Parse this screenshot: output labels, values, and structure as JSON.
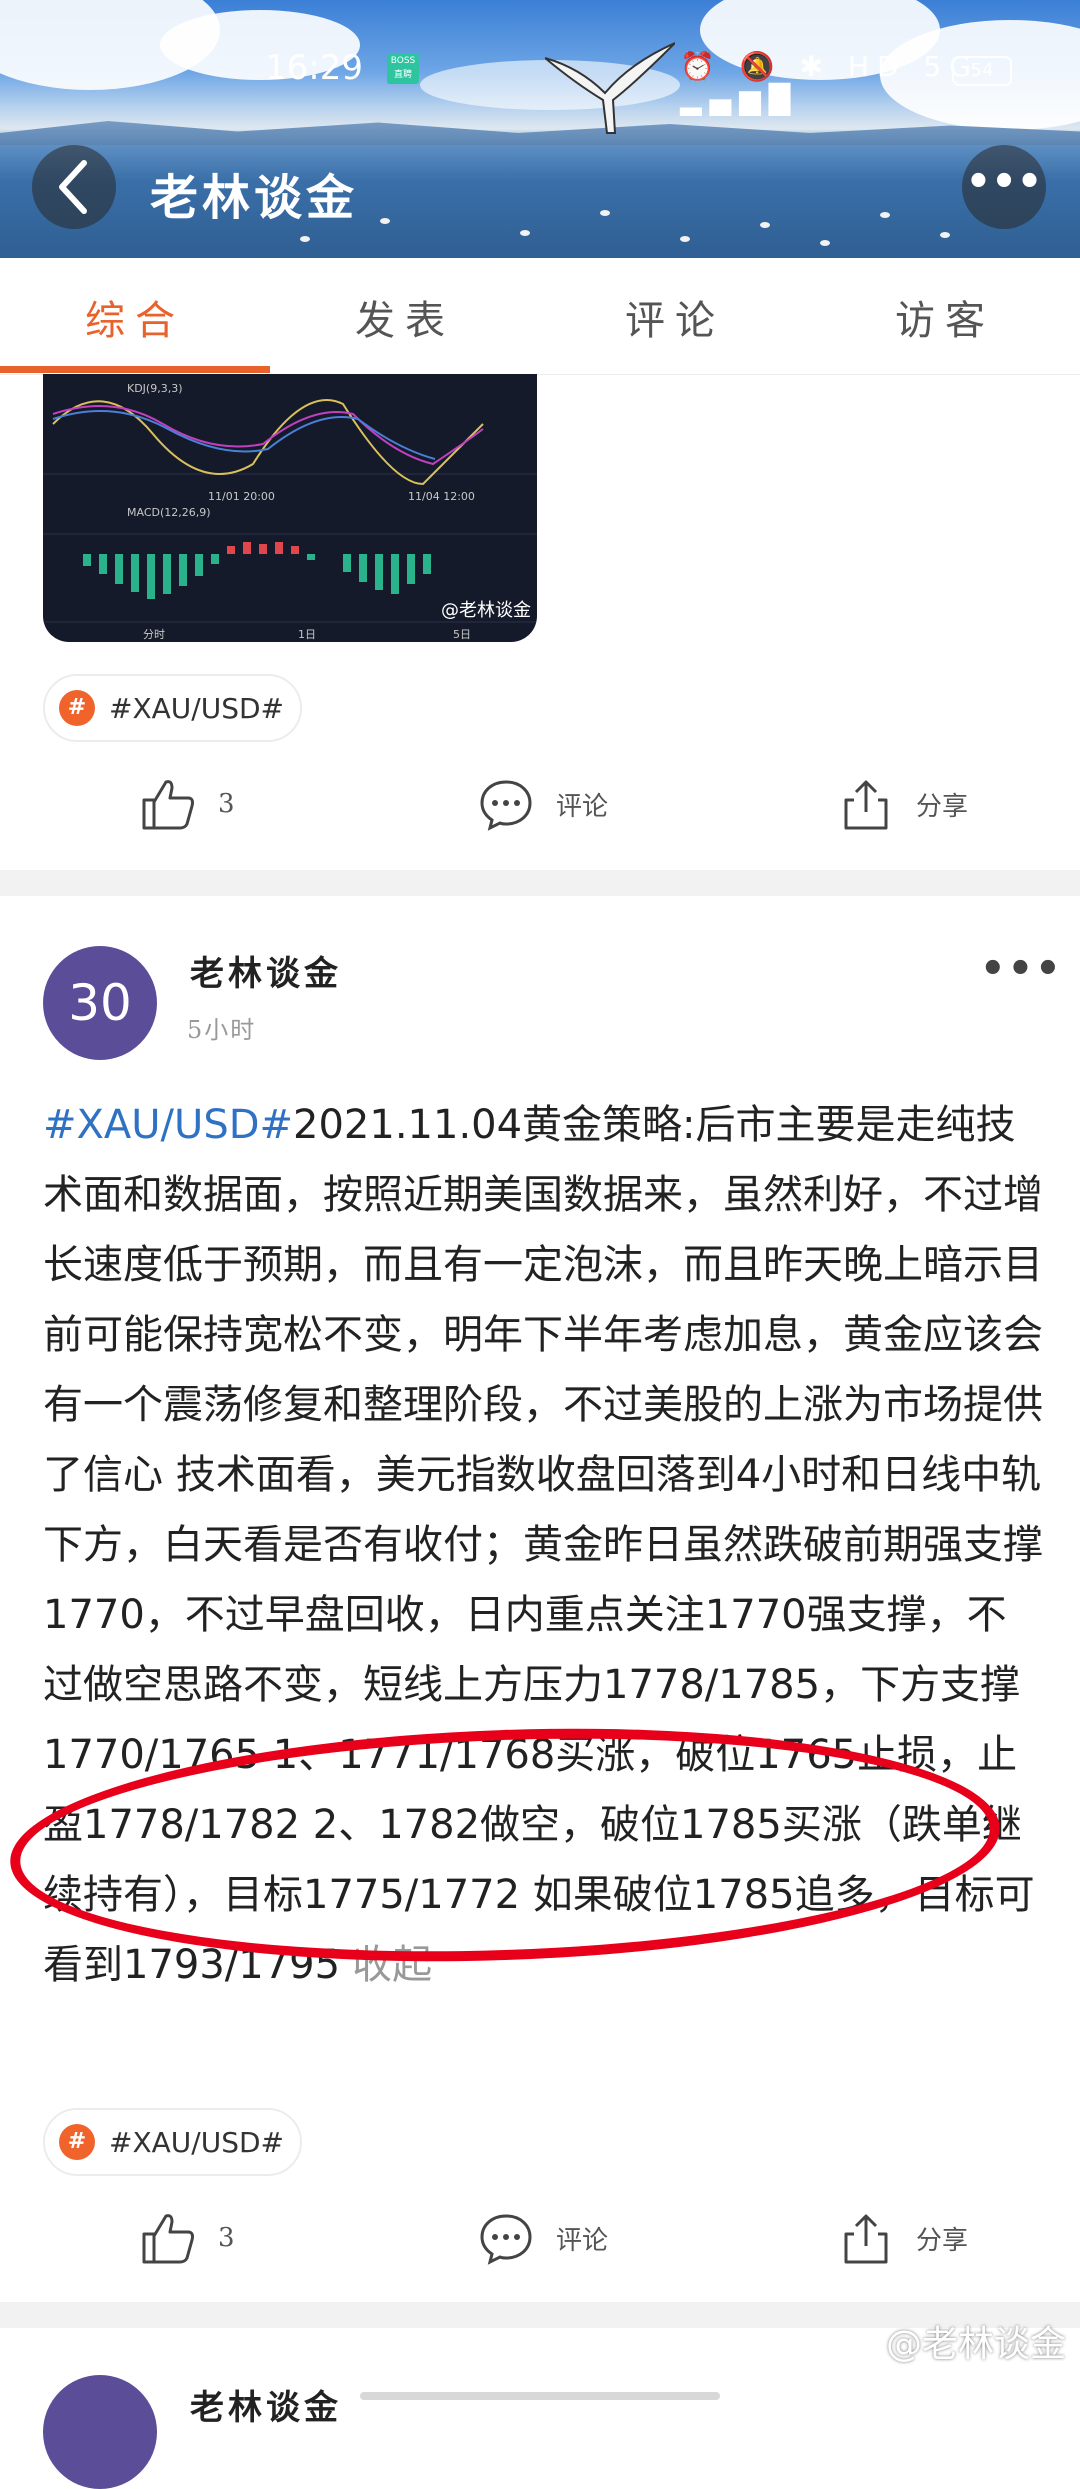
{
  "status_bar": {
    "time": "16:29",
    "boss_badge_top": "BOSS",
    "boss_badge_bottom": "直聘",
    "icons": "⏰ 🔕 ✱ HD 5G ▂▄▆█",
    "battery": "54"
  },
  "header": {
    "title": "老林谈金",
    "back_icon": "chevron-left-icon",
    "more_icon": "more-dots-icon"
  },
  "tabs": [
    {
      "label": "综合",
      "active": true
    },
    {
      "label": "发表",
      "active": false
    },
    {
      "label": "评论",
      "active": false
    },
    {
      "label": "访客",
      "active": false
    }
  ],
  "accent_color": "#e8622c",
  "prev_post": {
    "chart_labels": {
      "kdj": "KDJ(9,3,3)",
      "macd": "MACD(12,26,9)",
      "date1": "11/01 20:00",
      "date2": "11/04 12:00",
      "tab1": "分时",
      "tab2": "1日",
      "tab3": "5日",
      "watermark": "@老林谈金"
    },
    "tag": "#XAU/USD#",
    "likes": "3",
    "comment_label": "评论",
    "share_label": "分享"
  },
  "post": {
    "avatar_text": "30",
    "author": "老林谈金",
    "time_ago": "5小时",
    "tag_inline": "#XAU/USD#",
    "body": "2021.11.04黄金策略:后市主要是走纯技术面和数据面，按照近期美国数据来，虽然利好，不过增长速度低于预期，而且有一定泡沫，而且昨天晚上暗示目前可能保持宽松不变，明年下半年考虑加息，黄金应该会有一个震荡修复和整理阶段，不过美股的上涨为市场提供了信心 技术面看，美元指数收盘回落到4小时和日线中轨下方，白天看是否有收付；黄金昨日虽然跌破前期强支撑1770，不过早盘回收，日内重点关注1770强支撑，不过做空思路不变，短线上方压力1778/1785，下方支撑1770/1765 1、1771/1768买涨，破位1765止损，止盈1778/1782 2、1782做空，破位1785买涨（跌单继续持有），目标1775/1772 如果破位1785追多，目标可看到1793/1795",
    "collapse_label": "收起",
    "tag": "#XAU/USD#",
    "likes": "3",
    "comment_label": "评论",
    "share_label": "分享"
  },
  "page_watermark": "@老林谈金",
  "next_post": {
    "author": "老林谈金"
  }
}
